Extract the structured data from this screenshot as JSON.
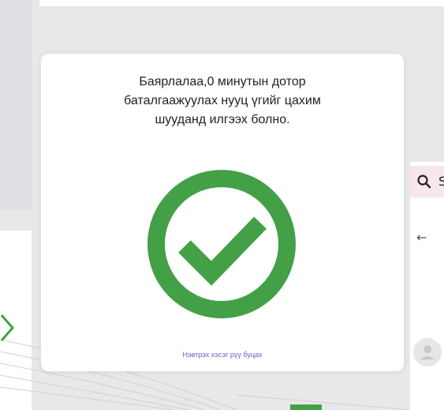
{
  "dialog": {
    "message_line1": "Баярлалаа,0 минутын дотор",
    "message_line2": "баталгаажуулах нууц үгийг цахим",
    "message_line3": "шууданд илгээх болно.",
    "back_link": "Нэвтрэх хэсэг рүү буцах"
  },
  "background": {
    "search_fragment": "S",
    "back_arrow": "←"
  },
  "colors": {
    "success": "#43a047",
    "link": "#6a5acd"
  },
  "icons": {
    "status": "check-circle-icon",
    "search": "search-icon",
    "back": "arrow-left-icon",
    "avatar": "user-icon"
  }
}
